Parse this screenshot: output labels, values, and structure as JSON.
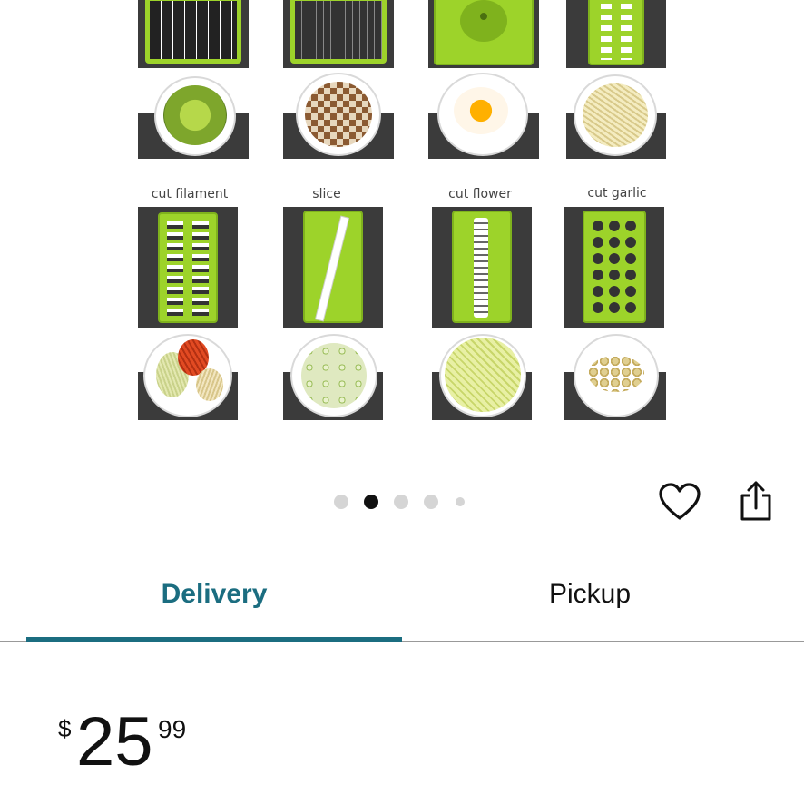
{
  "gallery": {
    "captions": [
      "cut filament",
      "slice",
      "cut flower",
      "cut garlic"
    ],
    "colors": {
      "blade": "#9dd32a",
      "dark": "#3b3b3b"
    }
  },
  "carousel": {
    "dot_count": 5,
    "active_index": 1
  },
  "actions": {
    "favorite_icon": "heart-icon",
    "share_icon": "share-icon"
  },
  "tabs": {
    "delivery": "Delivery",
    "pickup": "Pickup",
    "active": "Delivery",
    "accent": "#1b6d80"
  },
  "price": {
    "currency": "$",
    "whole": "25",
    "fraction": "99"
  }
}
